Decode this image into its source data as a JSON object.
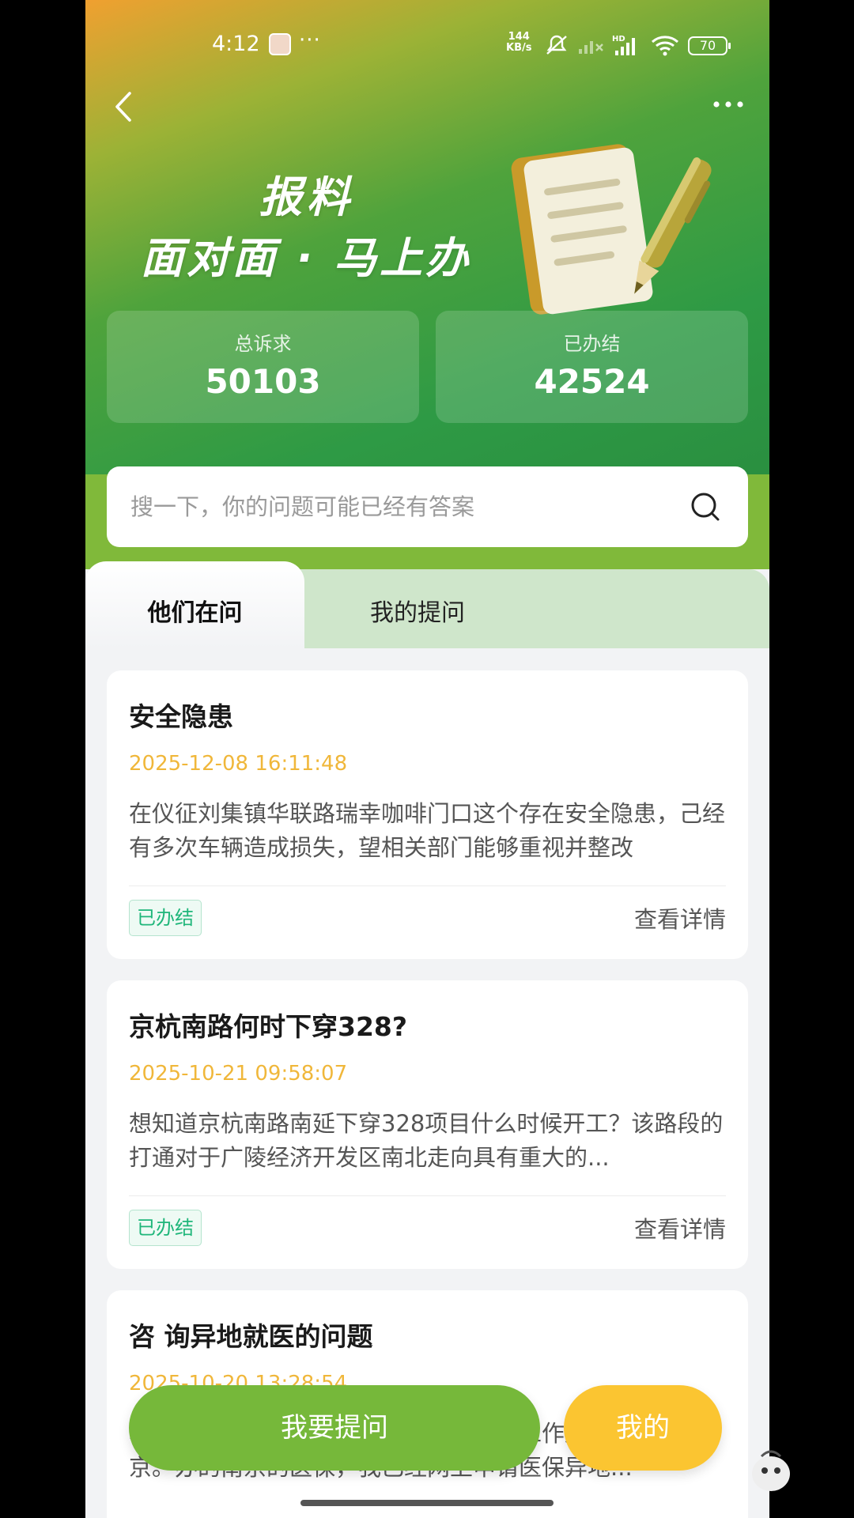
{
  "status_bar": {
    "time": "4:12",
    "dots": "···",
    "net_speed_value": "144",
    "net_speed_unit": "KB/s",
    "hd_label": "HD",
    "battery": "70"
  },
  "hero": {
    "slogan_line1": "报料",
    "slogan_line2": "面对面 · 马上办"
  },
  "stats": {
    "total_label": "总诉求",
    "total_value": "50103",
    "done_label": "已办结",
    "done_value": "42524"
  },
  "search": {
    "placeholder": "搜一下，你的问题可能已经有答案"
  },
  "tabs": [
    {
      "label": "他们在问",
      "active": true
    },
    {
      "label": "我的提问",
      "active": false
    }
  ],
  "cards": [
    {
      "title": "安全隐患",
      "date": "2025-12-08 16:11:48",
      "description": "在仪征刘集镇华联路瑞幸咖啡门口这个存在安全隐患，己经有多次车辆造成损失，望相关部门能够重视并整改",
      "status": "已办结",
      "link": "查看详情"
    },
    {
      "title": "京杭南路何时下穿328?",
      "date": "2025-10-21 09:58:07",
      "description": "想知道京杭南路南延下穿328项目什么时候开工？该路段的打通对于广陵经济开发区南北走向具有重大的...",
      "status": "已办结",
      "link": "查看详情"
    },
    {
      "title": "咨 询异地就医的问题",
      "date": "2025-10-20 13:28:54",
      "description": "本人现在南京工作，老家在扬州，因为工作原因经常在南京。办的南京的医保，我已经网上申请医保异地...",
      "status": "",
      "link": ""
    }
  ],
  "actions": {
    "ask_label": "我要提问",
    "mine_label": "我的"
  },
  "colors": {
    "brand_green": "#76b83a",
    "accent_yellow": "#fbc531",
    "date_color": "#f0b73a",
    "status_green": "#1fb67a"
  }
}
